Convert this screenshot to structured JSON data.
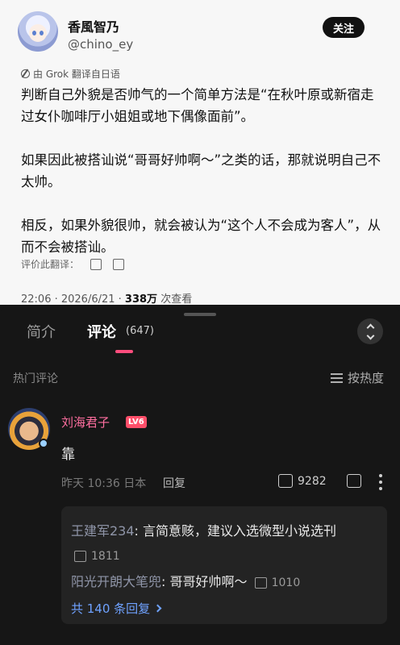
{
  "tweet": {
    "display_name": "香風智乃",
    "handle": "@chino_ey",
    "follow_label": "关注",
    "translation_note": "由 Grok 翻译自日语",
    "paragraphs": [
      "判断自己外貌是否帅气的一个简单方法是“在秋叶原或新宿走过女仆咖啡厅小姐姐或地下偶像面前”。",
      "如果因此被搭讪说“哥哥好帅啊～”之类的话，那就说明自己不太帅。",
      "相反，如果外貌很帅，就会被认为“这个人不会成为客人”，从而不会被搭讪。"
    ],
    "rate_label": "评价此翻译：",
    "timestamp": "22:06 · 2026/6/21 · ",
    "views": "338万",
    "views_suffix": " 次查看"
  },
  "panel": {
    "tab_intro": "简介",
    "tab_comments": "评论",
    "comment_count": "(647)",
    "hot_label": "热门评论",
    "sort_label": "按热度"
  },
  "comment": {
    "user": "刘海君子",
    "level": "LV6",
    "text": "靠",
    "meta": "昨天 10:36 日本",
    "reply_label": "回复",
    "likes": "9282",
    "replies": [
      {
        "user": "王建军234",
        "text": ": 言简意赅，建议入选微型小说选刊",
        "likes": "1811"
      },
      {
        "user": "阳光开朗大笔兜",
        "text": ": 哥哥好帅啊～",
        "likes": "1010"
      }
    ],
    "total_replies": "共 140 条回复"
  }
}
